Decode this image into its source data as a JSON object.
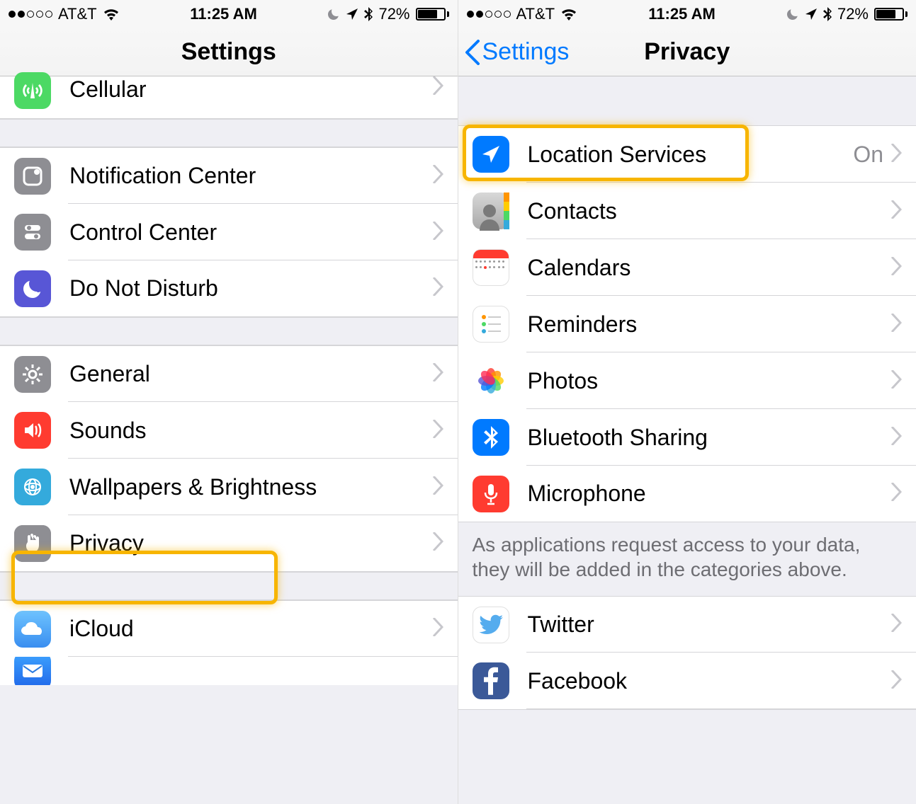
{
  "status": {
    "carrier": "AT&T",
    "time": "11:25 AM",
    "battery_pct": "72%"
  },
  "left": {
    "title": "Settings",
    "rows": {
      "cellular": "Cellular",
      "notification_center": "Notification Center",
      "control_center": "Control Center",
      "do_not_disturb": "Do Not Disturb",
      "general": "General",
      "sounds": "Sounds",
      "wallpapers": "Wallpapers & Brightness",
      "privacy": "Privacy",
      "icloud": "iCloud"
    }
  },
  "right": {
    "back_label": "Settings",
    "title": "Privacy",
    "rows": {
      "location_services": "Location Services",
      "location_services_value": "On",
      "contacts": "Contacts",
      "calendars": "Calendars",
      "reminders": "Reminders",
      "photos": "Photos",
      "bluetooth_sharing": "Bluetooth Sharing",
      "microphone": "Microphone",
      "twitter": "Twitter",
      "facebook": "Facebook"
    },
    "footer": "As applications request access to your data, they will be added in the categories above."
  }
}
